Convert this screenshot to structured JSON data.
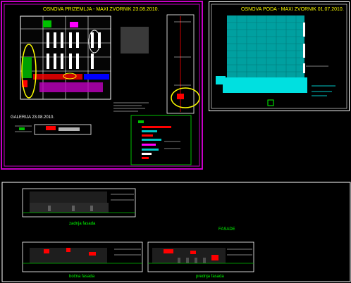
{
  "sheet_top_left": {
    "title": "OSNOVA PRIZEMLJA - MAXI ZVORNIK 23.08.2010.",
    "gallery_label": "GALERIJA  23.08.2010."
  },
  "sheet_top_right": {
    "title": "OSNOVA PODA - MAXI ZVORNIK 01.07.2010."
  },
  "sheet_bottom": {
    "group_label": "FASADE",
    "rear_facade": "zadnja fasada",
    "side_facade": "bočna fasada",
    "front_facade": "prednja fasada"
  },
  "colors": {
    "background": "#000000",
    "frame_magenta": "#c800c8",
    "frame_white": "#ffffff",
    "title_yellow": "#ffff00",
    "floor_cyan": "#00c8c8",
    "label_green": "#00ff00",
    "annotation_red": "#ff0000"
  }
}
